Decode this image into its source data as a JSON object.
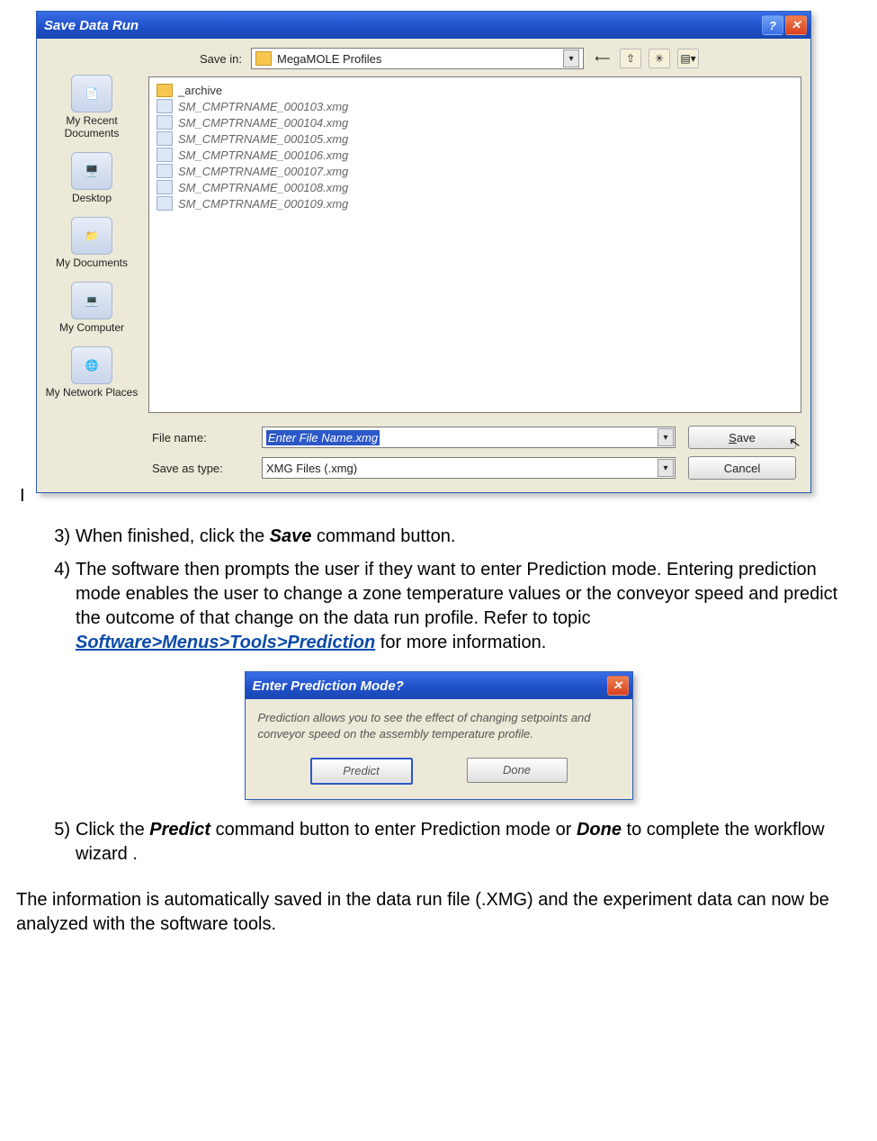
{
  "saveDialog": {
    "title": "Save Data Run",
    "saveInLabel": "Save in:",
    "saveInValue": "MegaMOLE Profiles",
    "places": [
      {
        "label": "My Recent Documents"
      },
      {
        "label": "Desktop"
      },
      {
        "label": "My Documents"
      },
      {
        "label": "My Computer"
      },
      {
        "label": "My Network Places"
      }
    ],
    "files": [
      {
        "name": "_archive",
        "type": "folder"
      },
      {
        "name": "SM_CMPTRNAME_000103.xmg",
        "type": "file"
      },
      {
        "name": "SM_CMPTRNAME_000104.xmg",
        "type": "file"
      },
      {
        "name": "SM_CMPTRNAME_000105.xmg",
        "type": "file"
      },
      {
        "name": "SM_CMPTRNAME_000106.xmg",
        "type": "file"
      },
      {
        "name": "SM_CMPTRNAME_000107.xmg",
        "type": "file"
      },
      {
        "name": "SM_CMPTRNAME_000108.xmg",
        "type": "file"
      },
      {
        "name": "SM_CMPTRNAME_000109.xmg",
        "type": "file"
      }
    ],
    "fileNameLabel": "File name:",
    "fileNameValue": "Enter File Name.xmg",
    "saveTypeLabel": "Save as type:",
    "saveTypeValue": "XMG Files (.xmg)",
    "saveBtn": "Save",
    "cancelBtn": "Cancel"
  },
  "steps": {
    "s3_pre": "When finished, click the ",
    "s3_bold": "Save",
    "s3_post": " command button.",
    "s4_a": "The software then prompts the user if they want to enter Prediction mode. Entering prediction mode enables the user to change a zone temperature values or the conveyor speed and predict the outcome of that change on the data run profile. Refer to topic ",
    "s4_link": "Software>Menus>Tools>Prediction",
    "s4_b": " for more information.",
    "s5_a": "Click the ",
    "s5_b1": "Predict",
    "s5_c": " command button to enter Prediction mode or ",
    "s5_b2": "Done",
    "s5_d": " to complete the workflow wizard ."
  },
  "predDialog": {
    "title": "Enter Prediction Mode?",
    "body": "Prediction allows you to see the effect of changing setpoints and conveyor speed on the assembly temperature profile.",
    "predictBtn": "Predict",
    "doneBtn": "Done"
  },
  "closing": "The information is automatically saved in the data run file (.XMG) and the experiment data can now be analyzed with the software tools."
}
